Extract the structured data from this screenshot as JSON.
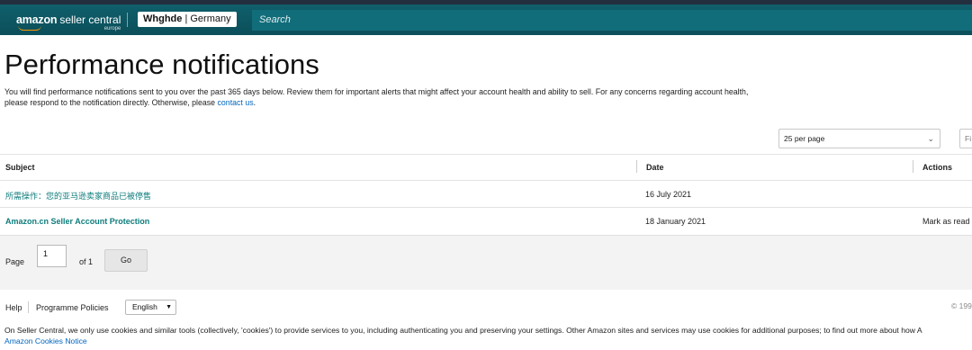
{
  "header": {
    "logo_brand": "amazon",
    "logo_product": "seller central",
    "logo_region": "europe",
    "store_name": "Whghde",
    "store_country": "Germany",
    "search_placeholder": "Search"
  },
  "page": {
    "title": "Performance notifications",
    "intro_text": "You will find performance notifications sent to you over the past 365 days below. Review them for important alerts that might affect your account health and ability to sell. For any concerns regarding account health, please respond to the notification directly. Otherwise, please",
    "intro_link": "contact us",
    "intro_end": "."
  },
  "controls": {
    "per_page": "25 per page",
    "filter_placeholder": "Fi"
  },
  "table": {
    "headers": {
      "subject": "Subject",
      "date": "Date",
      "actions": "Actions"
    },
    "rows": [
      {
        "subject": "所需操作：您的亚马逊卖家商品已被停售",
        "date": "16 July 2021",
        "action": ""
      },
      {
        "subject": "Amazon.cn Seller Account Protection",
        "date": "18 January 2021",
        "action": "Mark as read"
      }
    ]
  },
  "pagination": {
    "page_label": "Page",
    "current_page": "1",
    "of_label": "of 1",
    "go_label": "Go"
  },
  "footer": {
    "help": "Help",
    "programme_policies": "Programme Policies",
    "language": "English",
    "copyright": "© 199",
    "cookie_text": "On Seller Central, we only use cookies and similar tools (collectively, 'cookies') to provide services to you, including authenticating you and preserving your settings. Other Amazon sites and services may use cookies for additional purposes; to find out more about how A",
    "cookie_link": "Amazon Cookies Notice"
  }
}
